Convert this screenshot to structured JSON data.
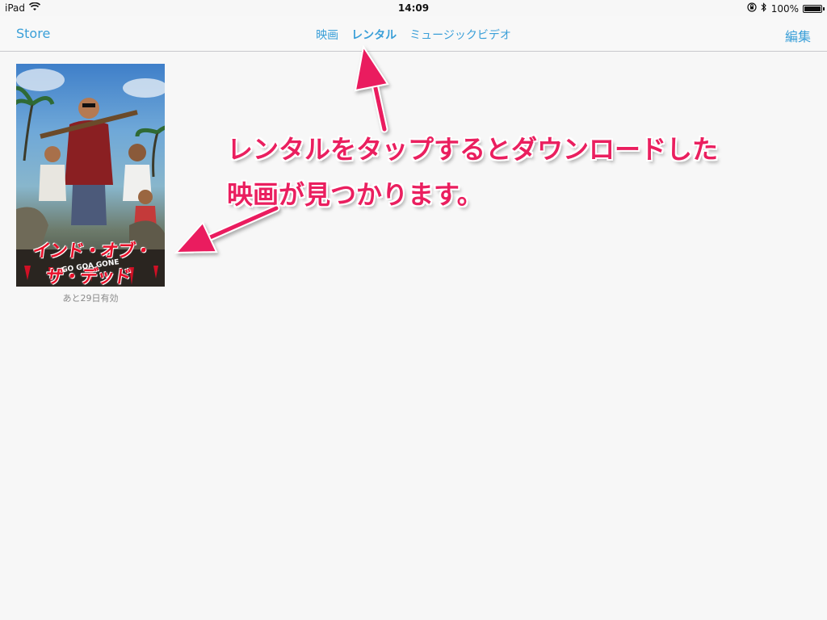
{
  "status_bar": {
    "device": "iPad",
    "time": "14:09",
    "battery": "100%",
    "battery_level": 1.0,
    "icons": [
      "wifi-icon",
      "orientation-lock-icon",
      "bluetooth-icon",
      "battery-icon"
    ]
  },
  "nav": {
    "store_label": "Store",
    "edit_label": "編集",
    "tabs": [
      {
        "label": "映画",
        "active": false
      },
      {
        "label": "レンタル",
        "active": true
      },
      {
        "label": "ミュージックビデオ",
        "active": false
      }
    ]
  },
  "library": {
    "items": [
      {
        "poster_title": "インド・オブ・ザ・デッド",
        "poster_subtitle": "GO GOA GONE",
        "caption": "あと29日有効"
      }
    ]
  },
  "annotation": {
    "line1": "レンタルをタップするとダウンロードした",
    "line2": "映画が見つかります。",
    "color": "#ea1f5f"
  },
  "colors": {
    "accent": "#3a9fd8",
    "background": "#f7f7f7"
  }
}
